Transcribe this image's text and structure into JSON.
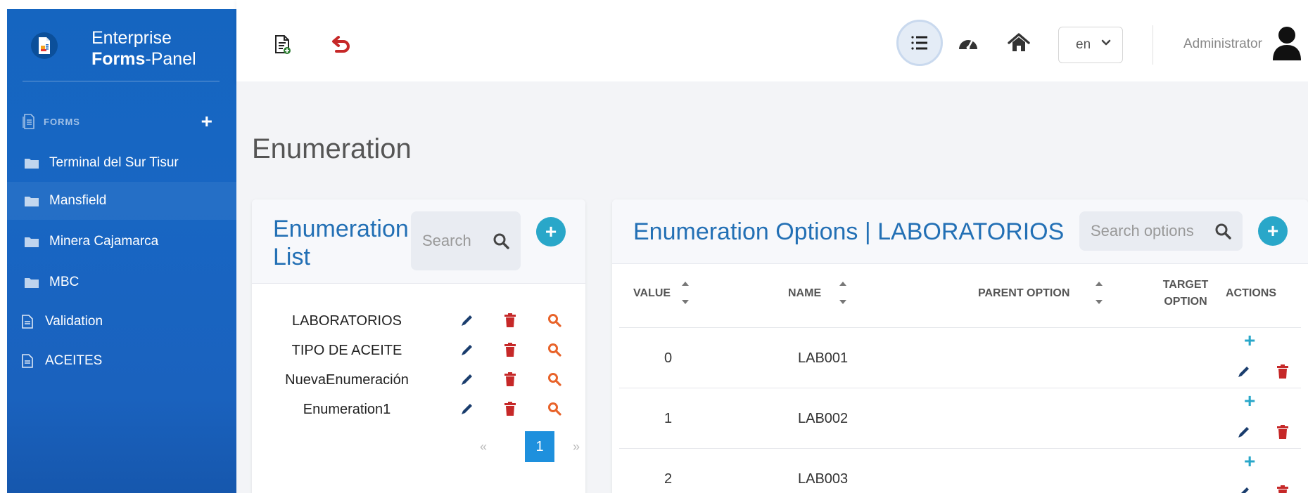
{
  "brand": {
    "line1": "Enterprise",
    "line2_bold": "Forms",
    "line2_rest": "-Panel"
  },
  "sidebar": {
    "section_label": "FORMS",
    "items": [
      {
        "label": "Terminal del Sur Tisur",
        "icon": "folder-icon"
      },
      {
        "label": "Mansfield",
        "icon": "folder-icon"
      },
      {
        "label": "Minera Cajamarca",
        "icon": "folder-icon"
      },
      {
        "label": "MBC",
        "icon": "folder-icon"
      },
      {
        "label": "Validation",
        "icon": "document-icon"
      },
      {
        "label": "ACEITES",
        "icon": "document-icon"
      }
    ]
  },
  "header": {
    "language": "en",
    "user": "Administrator"
  },
  "page": {
    "title": "Enumeration"
  },
  "enum_list": {
    "title_line1": "Enumeration",
    "title_line2": "List",
    "search_placeholder": "Search",
    "items": [
      "LABORATORIOS",
      "TIPO DE ACEITE",
      "NuevaEnumeración",
      "Enumeration1"
    ],
    "pagination": {
      "prev": "«",
      "current": "1",
      "next": "»"
    }
  },
  "options": {
    "title": "Enumeration Options | LABORATORIOS",
    "search_placeholder": "Search options",
    "columns": {
      "value": "VALUE",
      "name": "NAME",
      "parent": "PARENT OPTION",
      "target_line1": "TARGET",
      "target_line2": "OPTION",
      "actions": "ACTIONS"
    },
    "rows": [
      {
        "value": "0",
        "name": "LAB001"
      },
      {
        "value": "1",
        "name": "LAB002"
      },
      {
        "value": "2",
        "name": "LAB003"
      }
    ]
  },
  "colors": {
    "sidebar": "#1565c0",
    "accent": "#2370b5",
    "teal": "#29a7c9",
    "danger": "#c62828",
    "search": "#e8632a"
  }
}
